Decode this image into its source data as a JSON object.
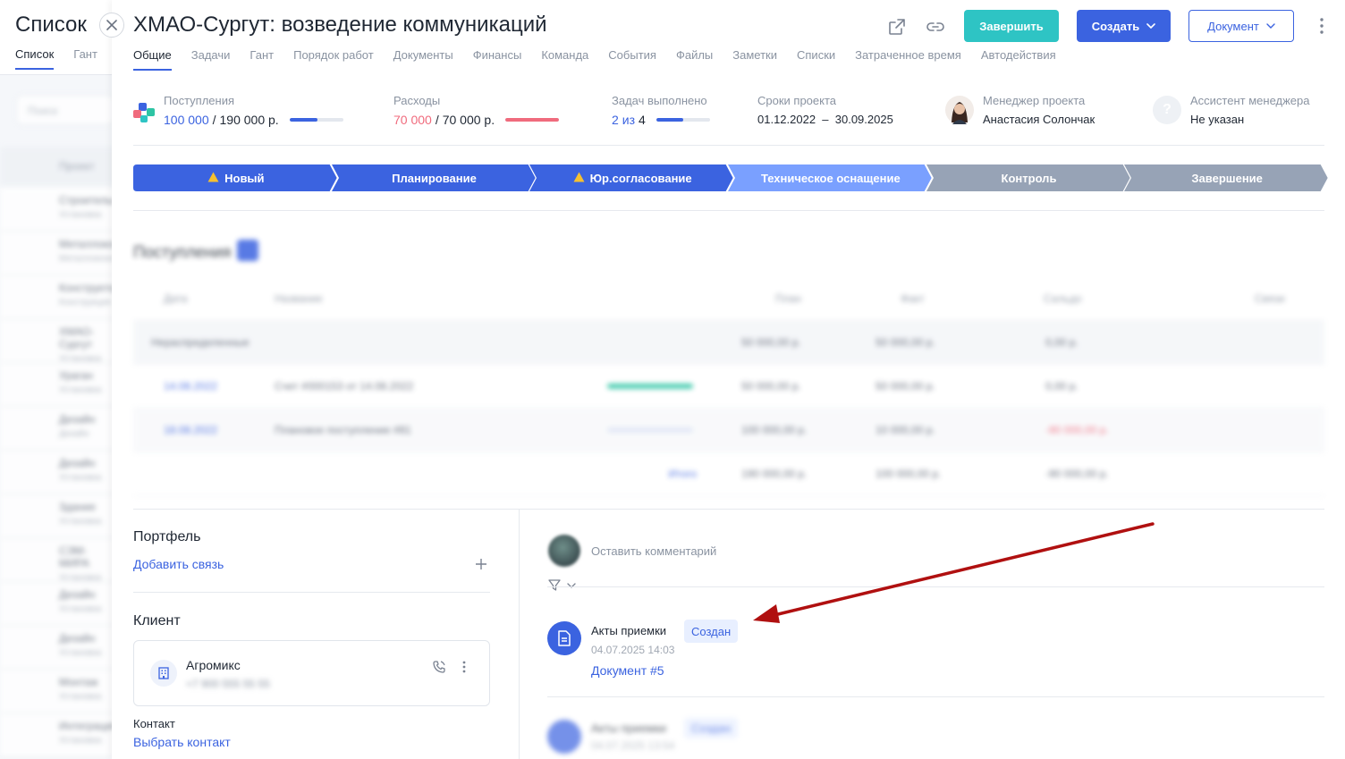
{
  "background": {
    "title": "Список",
    "tabs": [
      "Список",
      "Гант"
    ],
    "search_placeholder": "Поиск",
    "column_header": "Проект",
    "rows": [
      {
        "name": "Строительство",
        "sub": "Установка"
      },
      {
        "name": "Металлоконструкции",
        "sub": "Металлоконструкции"
      },
      {
        "name": "Конструкторская",
        "sub": "Конструкция"
      },
      {
        "name": "ХМАО-Сургут",
        "sub": "Установка"
      },
      {
        "name": "Ураган",
        "sub": "Установка"
      },
      {
        "name": "Дизайн",
        "sub": "Дизайн"
      },
      {
        "name": "Дизайн",
        "sub": "Установка"
      },
      {
        "name": "Здание",
        "sub": "Установка"
      },
      {
        "name": "СЭМ-МИРА",
        "sub": "Установка"
      },
      {
        "name": "Дизайн",
        "sub": "Установка"
      },
      {
        "name": "Дизайн",
        "sub": "Установка"
      },
      {
        "name": "Монтаж",
        "sub": "Установка"
      },
      {
        "name": "Интеграция",
        "sub": "Установка"
      }
    ]
  },
  "project": {
    "title": "ХМАО-Сургут: возведение коммуникаций",
    "tabs": [
      "Общие",
      "Задачи",
      "Гант",
      "Порядок работ",
      "Документы",
      "Финансы",
      "Команда",
      "События",
      "Файлы",
      "Заметки",
      "Списки",
      "Затраченное время",
      "Автодействия"
    ],
    "active_tab": "Общие",
    "buttons": {
      "finish": "Завершить",
      "create": "Создать",
      "document": "Документ"
    }
  },
  "stats": {
    "income": {
      "label": "Поступления",
      "actual": "100 000",
      "sep": " / ",
      "planned": "190 000 р.",
      "progress": 0.53
    },
    "expenses": {
      "label": "Расходы",
      "actual": "70 000",
      "sep": " / ",
      "planned": "70 000 р.",
      "progress": 1.0
    },
    "tasks": {
      "label": "Задач выполнено",
      "done": "2",
      "of": "из",
      "total": "4",
      "progress": 0.5
    },
    "deadlines": {
      "label": "Сроки проекта",
      "value": "01.12.2022  –  30.09.2025"
    },
    "manager": {
      "label": "Менеджер проекта",
      "name": "Анастасия Солончак"
    },
    "assistant": {
      "label": "Ассистент менеджера",
      "name": "Не указан"
    }
  },
  "stages": [
    {
      "label": "Новый",
      "warn": true,
      "state": "done"
    },
    {
      "label": "Планирование",
      "warn": false,
      "state": "done"
    },
    {
      "label": "Юр.согласование",
      "warn": true,
      "state": "done"
    },
    {
      "label": "Техническое оснащение",
      "warn": false,
      "state": "current"
    },
    {
      "label": "Контроль",
      "warn": false,
      "state": "future"
    },
    {
      "label": "Завершение",
      "warn": false,
      "state": "future"
    }
  ],
  "finance": {
    "title": "Поступления",
    "headers": [
      "Дата",
      "Название",
      "План",
      "Факт",
      "Сальдо",
      "Связи"
    ],
    "group": {
      "name": "Нераспределенные",
      "plan": "50 000,00 р.",
      "fact": "50 000,00 р.",
      "saldo": "0,00 р."
    },
    "rows": [
      {
        "date": "14.08.2022",
        "name": "Счет #000153 от 14.08.2022",
        "plan": "50 000,00 р.",
        "fact": "50 000,00 р.",
        "saldo": "0,00 р."
      },
      {
        "date": "18.08.2022",
        "name": "Плановое поступление #81",
        "plan": "100 000,00 р.",
        "fact": "10 000,00 р.",
        "saldo": "-90 000,00 р."
      }
    ],
    "total": {
      "label": "Итого",
      "plan": "190 000,00 р.",
      "fact": "100 000,00 р.",
      "saldo": "-90 000,00 р."
    }
  },
  "portfolio": {
    "title": "Портфель",
    "add_link": "Добавить связь"
  },
  "client": {
    "title": "Клиент",
    "name": "Агромикс",
    "phone": "+7 900 555 55 55"
  },
  "contact": {
    "label": "Контакт",
    "link": "Выбрать контакт"
  },
  "comments": {
    "placeholder": "Оставить комментарий",
    "event": {
      "title": "Акты приемки",
      "badge": "Создан",
      "time": "04.07.2025 14:03",
      "link": "Документ #5"
    },
    "event2": {
      "title": "Акты приемки",
      "badge": "Создан",
      "time": "04.07.2025 13:54"
    }
  },
  "colors": {
    "accent": "#3b63e0",
    "teal": "#2ec4c4",
    "red": "#f06b7d",
    "annotation": "#b01010"
  }
}
